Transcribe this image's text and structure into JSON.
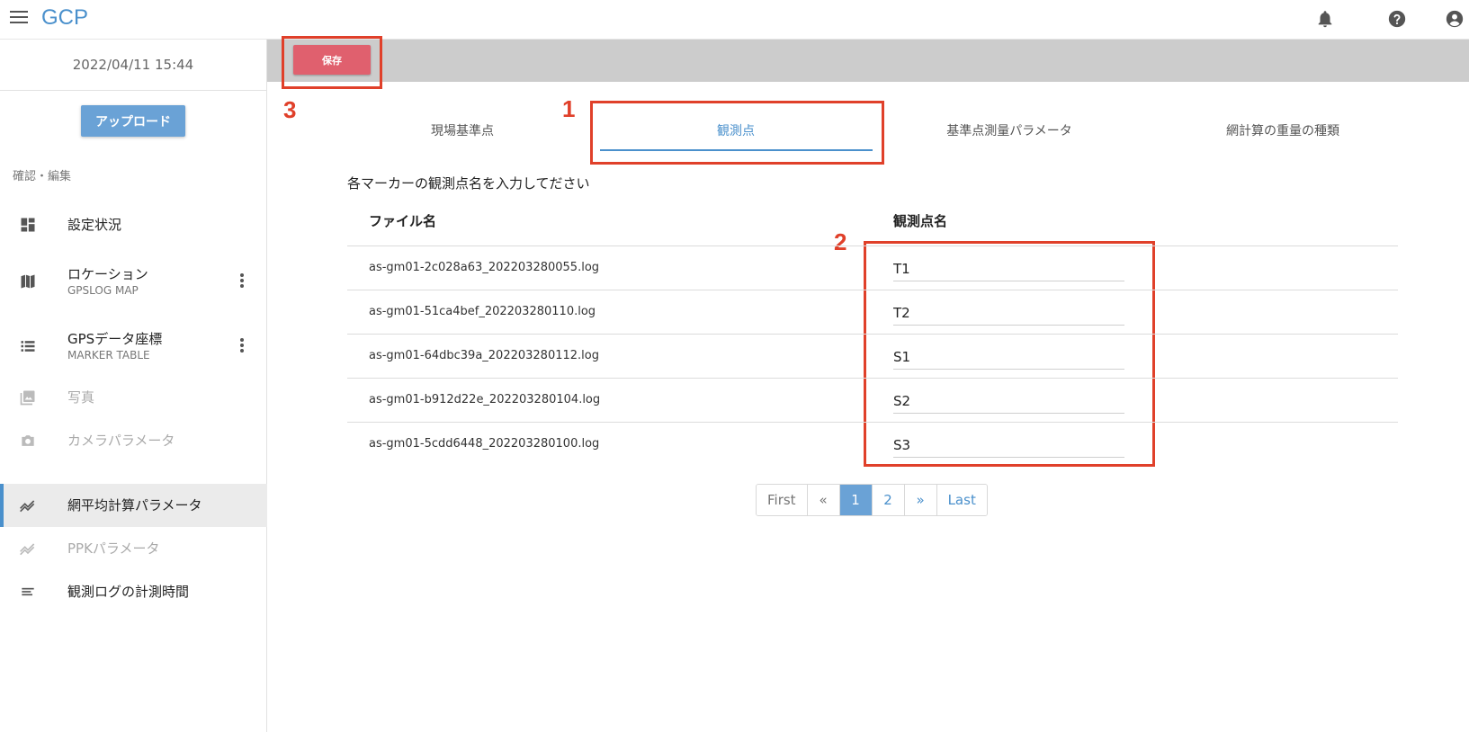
{
  "header": {
    "title": "GCP"
  },
  "sidebar": {
    "datetime": "2022/04/11 15:44",
    "upload_label": "アップロード",
    "section_label": "確認・編集",
    "items": [
      {
        "label": "設定状況",
        "sub": ""
      },
      {
        "label": "ロケーション",
        "sub": "GPSLOG MAP"
      },
      {
        "label": "GPSデータ座標",
        "sub": "MARKER TABLE"
      },
      {
        "label": "写真",
        "sub": ""
      },
      {
        "label": "カメラパラメータ",
        "sub": ""
      },
      {
        "label": "網平均計算パラメータ",
        "sub": ""
      },
      {
        "label": "PPKパラメータ",
        "sub": ""
      },
      {
        "label": "観測ログの計測時間",
        "sub": ""
      }
    ]
  },
  "toolbar": {
    "save_label": "保存"
  },
  "tabs": [
    {
      "label": "現場基準点"
    },
    {
      "label": "観測点"
    },
    {
      "label": "基準点測量パラメータ"
    },
    {
      "label": "網計算の重量の種類"
    }
  ],
  "main": {
    "instruction": "各マーカーの観測点名を入力してださい",
    "columns": {
      "file": "ファイル名",
      "point": "観測点名"
    },
    "rows": [
      {
        "file": "as-gm01-2c028a63_202203280055.log",
        "point": "T1"
      },
      {
        "file": "as-gm01-51ca4bef_202203280110.log",
        "point": "T2"
      },
      {
        "file": "as-gm01-64dbc39a_202203280112.log",
        "point": "S1"
      },
      {
        "file": "as-gm01-b912d22e_202203280104.log",
        "point": "S2"
      },
      {
        "file": "as-gm01-5cdd6448_202203280100.log",
        "point": "S3"
      }
    ]
  },
  "pagination": {
    "first": "First",
    "prev": "«",
    "pages": [
      "1",
      "2"
    ],
    "next": "»",
    "last": "Last"
  },
  "annotations": [
    "1",
    "2",
    "3"
  ],
  "colors": {
    "accent": "#4a90cc",
    "save": "#e0606e",
    "annotation": "#e0402a",
    "toolbar": "#cccccc"
  }
}
